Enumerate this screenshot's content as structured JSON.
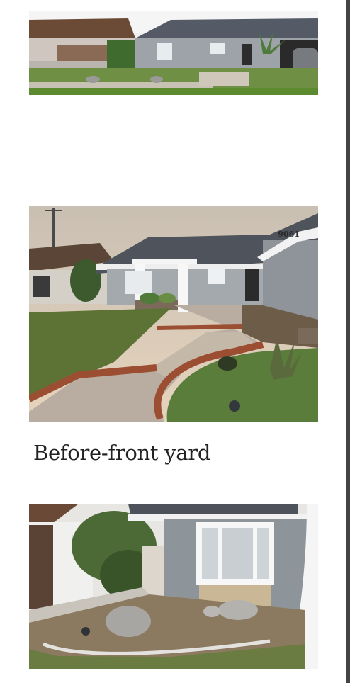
{
  "photos": [
    {
      "alt": "House front view from across the street"
    },
    {
      "alt": "Front yard with curved walkway and pergola"
    },
    {
      "alt": "Side yard with bay window and boulders"
    }
  ],
  "caption": "Before-front yard",
  "house_number": "9061"
}
